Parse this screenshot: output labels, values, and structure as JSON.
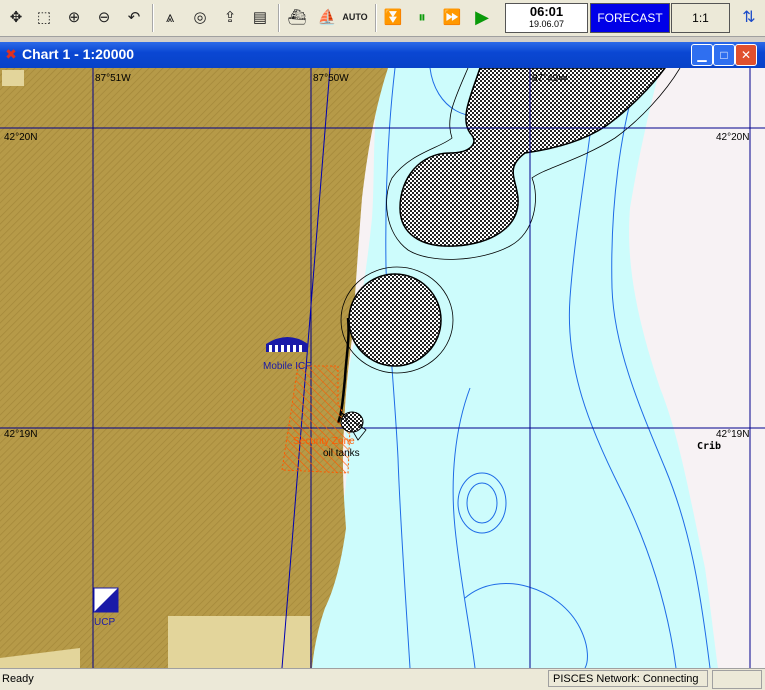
{
  "toolbar": {
    "buttons": [
      {
        "icon": "move-arrows-icon"
      },
      {
        "icon": "zoom-window-icon"
      },
      {
        "icon": "zoom-in-icon"
      },
      {
        "icon": "zoom-out-icon"
      },
      {
        "icon": "undo-icon"
      },
      {
        "icon": "compass-icon"
      },
      {
        "icon": "target-icon"
      },
      {
        "icon": "export-icon"
      },
      {
        "icon": "layers-icon"
      },
      {
        "icon": "ship-view-icon"
      },
      {
        "icon": "ship-track-icon"
      },
      {
        "icon": "auto-mode-icon",
        "label": "AUTO"
      },
      {
        "icon": "step-down-icon"
      },
      {
        "icon": "pause-icon"
      },
      {
        "icon": "fast-forward-icon"
      },
      {
        "icon": "play-icon"
      }
    ],
    "time": "06:01",
    "date": "19.06.07",
    "forecast_label": "FORECAST",
    "scale_label": "1:1"
  },
  "window": {
    "title": "Chart 1 - 1:20000"
  },
  "map": {
    "longitude_labels": [
      "87°51W",
      "87°50W",
      "87°49W"
    ],
    "latitude_labels_left": [
      "42°20N",
      "42°19N"
    ],
    "latitude_labels_right": [
      "42°20N",
      "42°19N"
    ],
    "features": {
      "mobile_icp": "Mobile ICP",
      "security_zone": "Security Zone",
      "oil_tanks": "oil tanks",
      "crib": "Crib",
      "ucp": "UCP"
    },
    "colors": {
      "land": "#b69a48",
      "water_shallow": "#cdfcfc",
      "water_deep": "#f7f2f4",
      "grid": "#00008c",
      "depth_contour": "#1e6be6",
      "security_zone": "#ff5a00"
    }
  },
  "status": {
    "ready": "Ready",
    "network": "PISCES Network: Connecting"
  }
}
